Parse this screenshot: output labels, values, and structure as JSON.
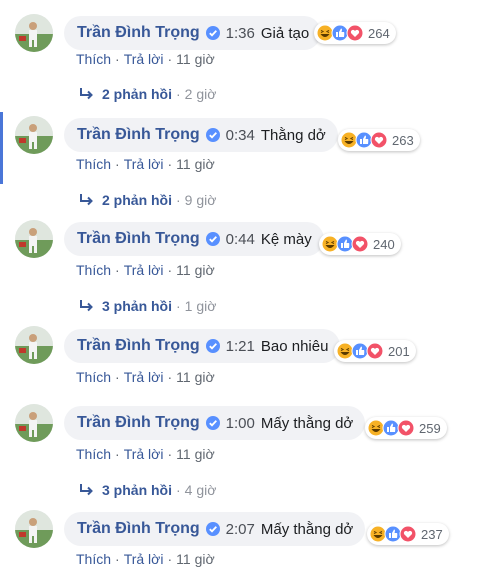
{
  "colors": {
    "link": "#385898",
    "bubble": "#f1f2f5",
    "active_bar": "#4a76d8",
    "like": "#5890ff",
    "love": "#f25268",
    "haha": "#f7b125"
  },
  "icons": {
    "verified": "verified-badge-icon",
    "reply_arrow": "reply-arrow-icon",
    "reactions": [
      "haha-icon",
      "like-icon",
      "love-icon"
    ]
  },
  "comments": [
    {
      "author": "Trần Đình Trọng",
      "timestamp": "1:36",
      "text": "Giả tạo",
      "reaction_count": "264",
      "like_label": "Thích",
      "reply_label": "Trả lời",
      "age": "11 giờ",
      "replies_label": "2 phản hồi",
      "replies_age": "2 giờ"
    },
    {
      "author": "Trần Đình Trọng",
      "timestamp": "0:34",
      "text": "Thằng dở",
      "reaction_count": "263",
      "like_label": "Thích",
      "reply_label": "Trả lời",
      "age": "11 giờ",
      "replies_label": "2 phản hồi",
      "replies_age": "9 giờ"
    },
    {
      "author": "Trần Đình Trọng",
      "timestamp": "0:44",
      "text": "Kệ mày",
      "reaction_count": "240",
      "like_label": "Thích",
      "reply_label": "Trả lời",
      "age": "11 giờ",
      "replies_label": "3 phản hồi",
      "replies_age": "1 giờ"
    },
    {
      "author": "Trần Đình Trọng",
      "timestamp": "1:21",
      "text": "Bao nhiêu",
      "reaction_count": "201",
      "like_label": "Thích",
      "reply_label": "Trả lời",
      "age": "11 giờ"
    },
    {
      "author": "Trần Đình Trọng",
      "timestamp": "1:00",
      "text": "Mấy thằng dở",
      "reaction_count": "259",
      "like_label": "Thích",
      "reply_label": "Trả lời",
      "age": "11 giờ",
      "replies_label": "3 phản hồi",
      "replies_age": "4 giờ"
    },
    {
      "author": "Trần Đình Trọng",
      "timestamp": "2:07",
      "text": "Mấy thằng dở",
      "reaction_count": "237",
      "like_label": "Thích",
      "reply_label": "Trả lời",
      "age": "11 giờ"
    }
  ]
}
